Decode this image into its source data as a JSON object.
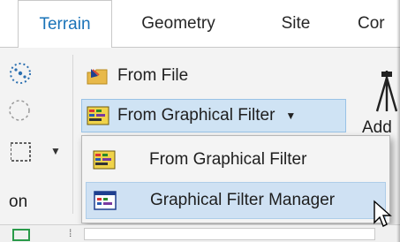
{
  "tabs": [
    {
      "label": "Terrain",
      "active": true
    },
    {
      "label": "Geometry",
      "active": false
    },
    {
      "label": "Site",
      "active": false
    },
    {
      "label": "Cor",
      "active": false
    }
  ],
  "ribbon": {
    "from_file_label": "From File",
    "from_graphical_filter_label": "From Graphical Filter",
    "dropdown_caret": "▼",
    "add_label_partial": "Add",
    "on_label_partial": "on"
  },
  "menu": {
    "items": [
      {
        "label": "From Graphical Filter",
        "icon": "graphical-filter-icon",
        "hover": false
      },
      {
        "label": "Graphical Filter Manager",
        "icon": "filter-manager-icon",
        "hover": true
      }
    ]
  },
  "colors": {
    "accent": "#1a73b8",
    "split_button_bg": "#cfe3f4",
    "menu_hover_bg": "#cfe1f3"
  }
}
